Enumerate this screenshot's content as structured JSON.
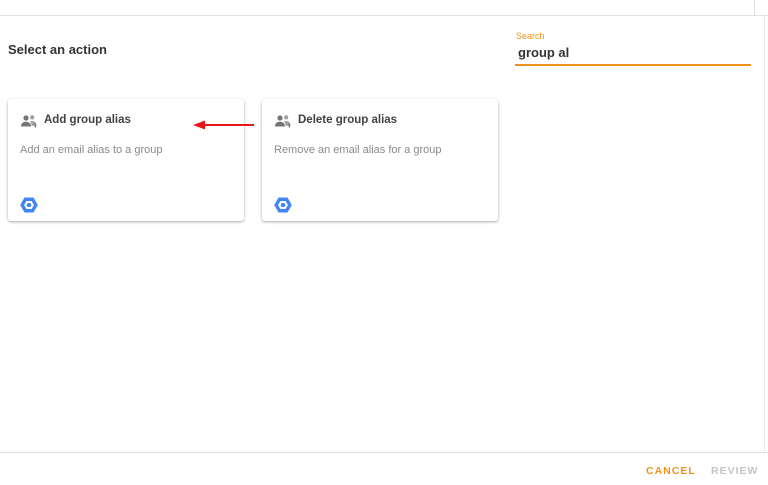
{
  "page": {
    "title": "Select an action"
  },
  "search": {
    "label": "Search",
    "value": "group al"
  },
  "cards": [
    {
      "title": "Add group alias",
      "description": "Add an email alias to a group",
      "icon": "group-icon",
      "provider_icon": "google-cloud-hexagon-icon"
    },
    {
      "title": "Delete group alias",
      "description": "Remove an email alias for a group",
      "icon": "group-icon",
      "provider_icon": "google-cloud-hexagon-icon"
    }
  ],
  "footer": {
    "cancel_label": "CANCEL",
    "review_label": "REVIEW"
  },
  "colors": {
    "accent": "#f0931e",
    "provider_blue": "#4285f4",
    "annotation_red": "#e8151b",
    "disabled": "#c4c4c4"
  }
}
